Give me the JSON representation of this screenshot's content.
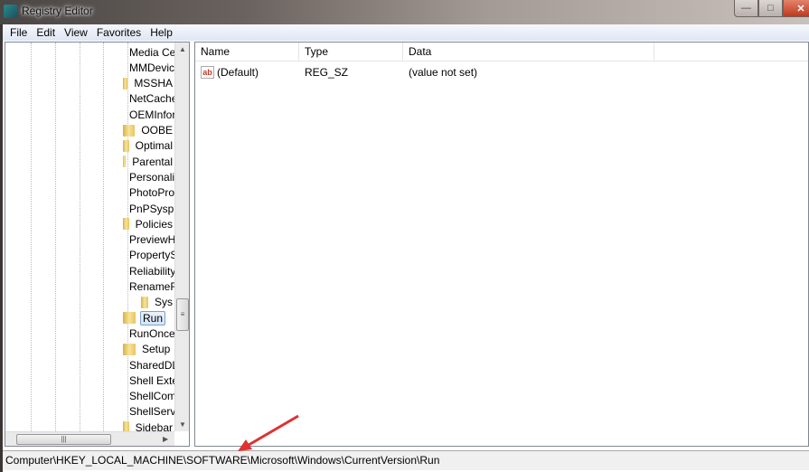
{
  "window": {
    "title": "Registry Editor",
    "minimize": "—",
    "maximize": "□",
    "close": "✕"
  },
  "menu": [
    "File",
    "Edit",
    "View",
    "Favorites",
    "Help"
  ],
  "tree": [
    {
      "label": "Media Center",
      "expander": "collapsed"
    },
    {
      "label": "MMDevices",
      "expander": "collapsed"
    },
    {
      "label": "MSSHA",
      "expander": "none"
    },
    {
      "label": "NetCache",
      "expander": "collapsed"
    },
    {
      "label": "OEMInformation",
      "expander": "none"
    },
    {
      "label": "OOBE",
      "expander": "none"
    },
    {
      "label": "Optimal",
      "expander": "none"
    },
    {
      "label": "Parental",
      "expander": "collapsed"
    },
    {
      "label": "Personalization",
      "expander": "none"
    },
    {
      "label": "PhotoPropertyHandler",
      "expander": "collapsed"
    },
    {
      "label": "PnPSysprep",
      "expander": "collapsed"
    },
    {
      "label": "Policies",
      "expander": "collapsed"
    },
    {
      "label": "PreviewHandlers",
      "expander": "none"
    },
    {
      "label": "PropertySystem",
      "expander": "collapsed"
    },
    {
      "label": "Reliability",
      "expander": "collapsed"
    },
    {
      "label": "RenameFiles",
      "expander": "expanded"
    },
    {
      "label": "Sys",
      "expander": "none",
      "child": true
    },
    {
      "label": "Run",
      "expander": "none",
      "selected": true
    },
    {
      "label": "RunOnce",
      "expander": "none"
    },
    {
      "label": "Setup",
      "expander": "collapsed"
    },
    {
      "label": "SharedDLLs",
      "expander": "none"
    },
    {
      "label": "Shell Extensions",
      "expander": "collapsed"
    },
    {
      "label": "ShellCompatibility",
      "expander": "collapsed"
    },
    {
      "label": "ShellServiceObjectDelayLoad",
      "expander": "none"
    },
    {
      "label": "Sidebar",
      "expander": "collapsed"
    }
  ],
  "list": {
    "columns": [
      "Name",
      "Type",
      "Data"
    ],
    "rows": [
      {
        "name": "(Default)",
        "type": "REG_SZ",
        "data": "(value not set)"
      }
    ]
  },
  "status": "Computer\\HKEY_LOCAL_MACHINE\\SOFTWARE\\Microsoft\\Windows\\CurrentVersion\\Run",
  "annotation_color": "#e03030"
}
